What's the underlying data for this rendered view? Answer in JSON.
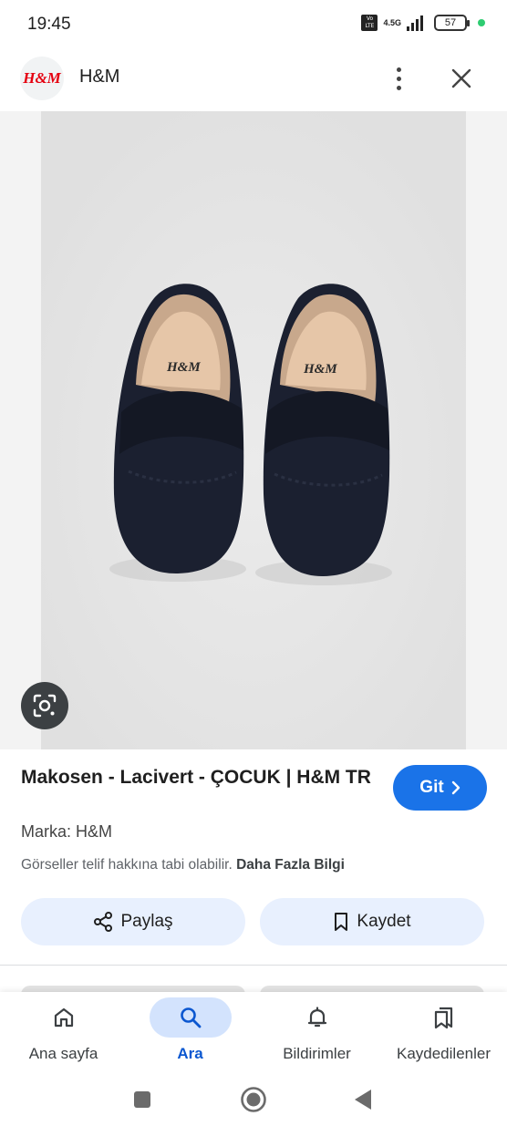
{
  "status_bar": {
    "time": "19:45",
    "volte": "Vo LTE",
    "network": "4.5G",
    "battery": "57"
  },
  "header": {
    "logo_text": "H&M",
    "site_name": "H&M",
    "more_icon": "more-vert-icon",
    "close_icon": "close-icon"
  },
  "product_image": {
    "insole_text": "H&M",
    "lens_icon": "google-lens-icon"
  },
  "result": {
    "title": "Makosen - Lacivert - ÇOCUK | H&M TR",
    "go_label": "Git",
    "brand": "Marka: H&M",
    "copyright_text": "Görseller telif hakkına tabi olabilir.",
    "more_info_link": "Daha Fazla Bilgi",
    "share_label": "Paylaş",
    "save_label": "Kaydet"
  },
  "bottom_nav": {
    "items": [
      {
        "label": "Ana sayfa",
        "icon": "home-icon"
      },
      {
        "label": "Ara",
        "icon": "search-icon",
        "active": true
      },
      {
        "label": "Bildirimler",
        "icon": "bell-icon"
      },
      {
        "label": "Kaydedilenler",
        "icon": "bookmarks-icon"
      }
    ]
  },
  "colors": {
    "accent": "#1a73e8",
    "chip_bg": "#e8f0fe",
    "active_pill": "#d3e3fd",
    "active_text": "#0b57d0",
    "brand_red": "#e50010",
    "shoe_navy": "#1b2030"
  }
}
